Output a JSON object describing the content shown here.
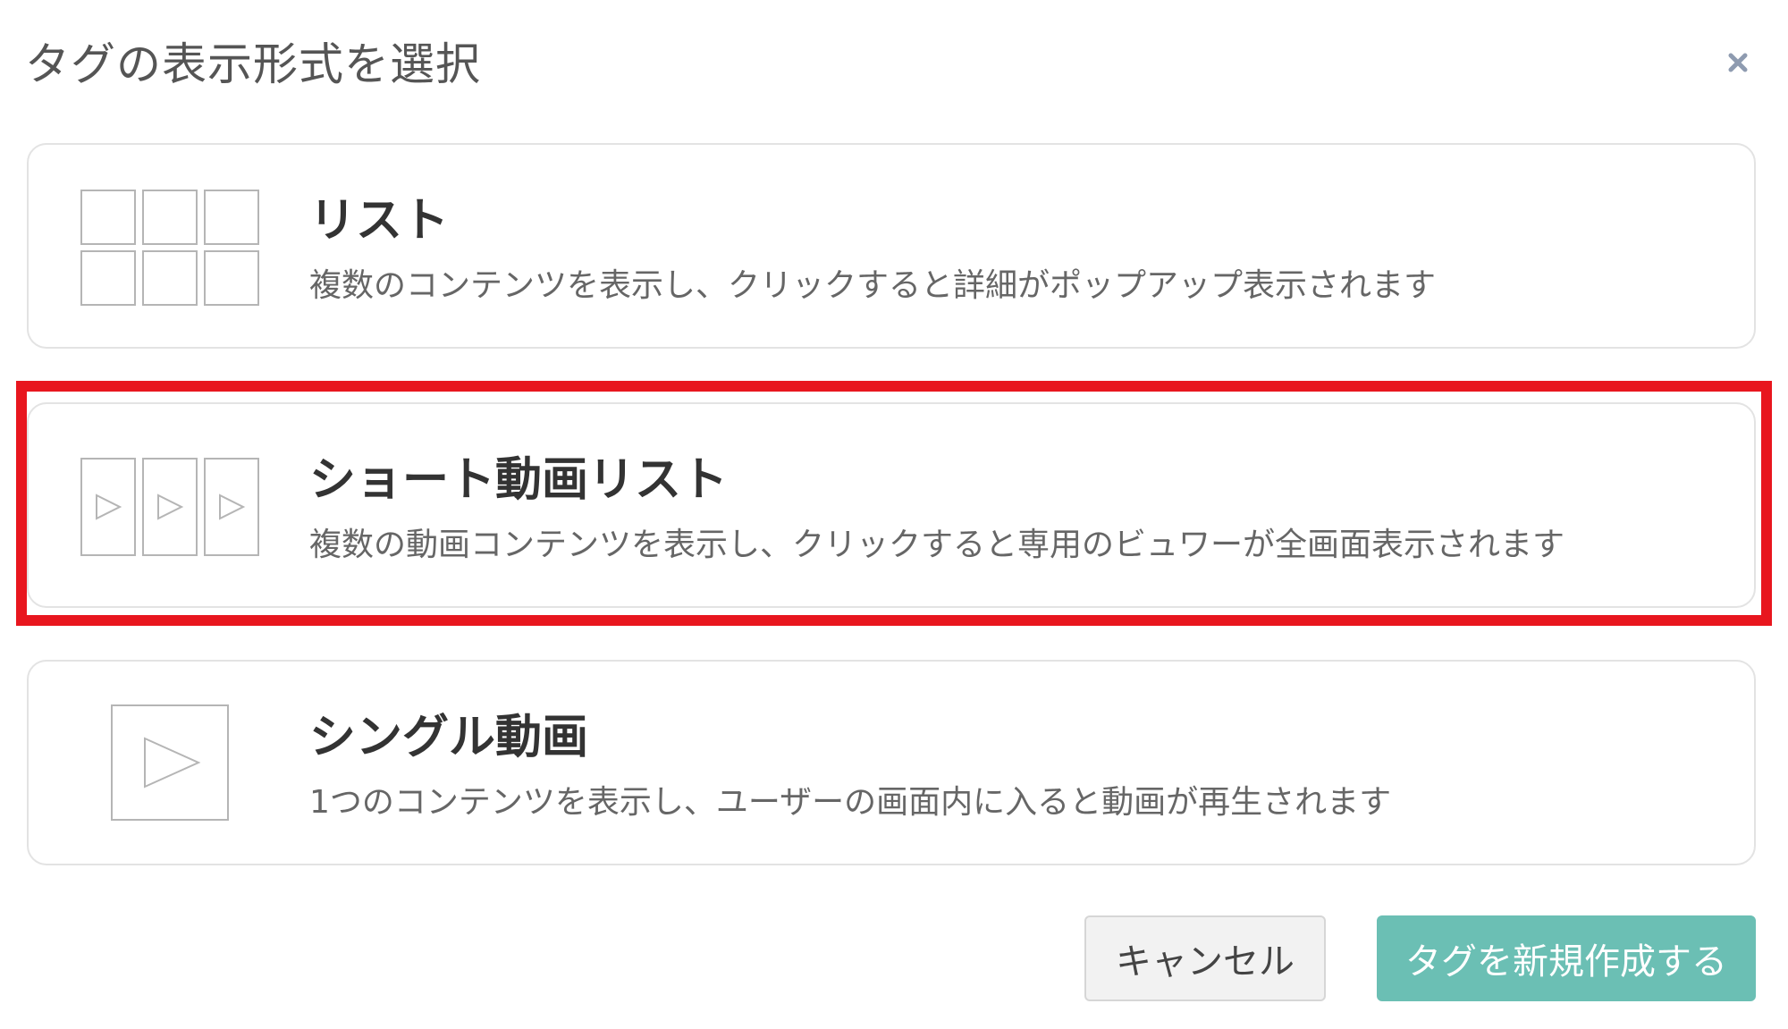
{
  "dialog": {
    "title": "タグの表示形式を選択",
    "close_icon": "close-icon"
  },
  "options": [
    {
      "title": "リスト",
      "description": "複数のコンテンツを表示し、クリックすると詳細がポップアップ表示されます",
      "icon": "grid-icon"
    },
    {
      "title": "ショート動画リスト",
      "description": "複数の動画コンテンツを表示し、クリックすると専用のビュワーが全画面表示されます",
      "icon": "short-video-list-icon",
      "highlighted": true
    },
    {
      "title": "シングル動画",
      "description": "1つのコンテンツを表示し、ユーザーの画面内に入ると動画が再生されます",
      "icon": "play-icon"
    }
  ],
  "footer": {
    "cancel_label": "キャンセル",
    "create_label": "タグを新規作成する"
  },
  "colors": {
    "highlight": "#e8161e",
    "primary_button": "#6bbfb4",
    "cancel_button": "#f2f2f2"
  }
}
